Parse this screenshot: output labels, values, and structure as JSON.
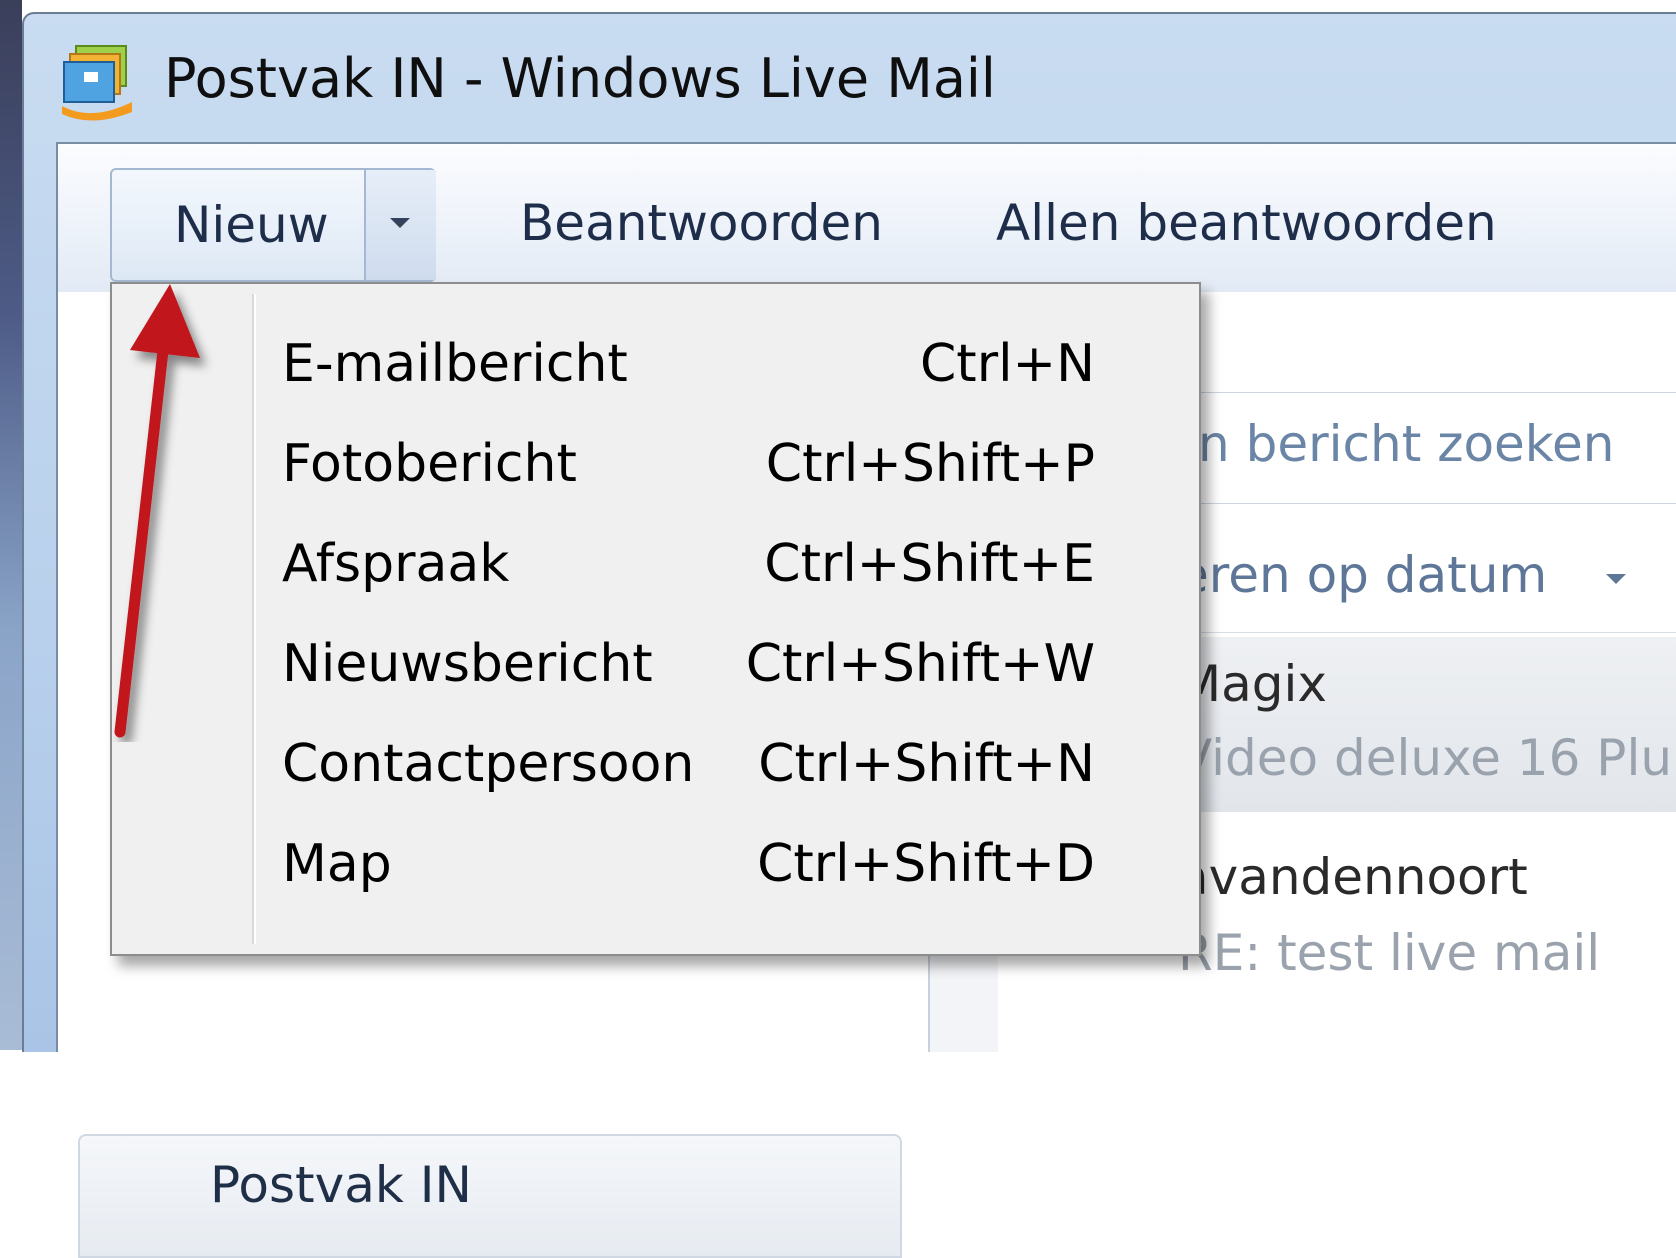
{
  "window": {
    "title": "Postvak IN - Windows Live Mail"
  },
  "toolbar": {
    "new_label": "Nieuw",
    "reply_label": "Beantwoorden",
    "reply_all_label": "Allen beantwoorden"
  },
  "new_menu": {
    "items": [
      {
        "label": "E-mailbericht",
        "shortcut": "Ctrl+N"
      },
      {
        "label": "Fotobericht",
        "shortcut": "Ctrl+Shift+P"
      },
      {
        "label": "Afspraak",
        "shortcut": "Ctrl+Shift+E"
      },
      {
        "label": "Nieuwsbericht",
        "shortcut": "Ctrl+Shift+W"
      },
      {
        "label": "Contactpersoon",
        "shortcut": "Ctrl+Shift+N"
      },
      {
        "label": "Map",
        "shortcut": "Ctrl+Shift+D"
      }
    ]
  },
  "folders": {
    "inbox_label": "Postvak IN"
  },
  "message_list": {
    "search_placeholder": "n bericht zoeken",
    "sort_label": "eren op datum",
    "messages": [
      {
        "from": "Magix",
        "subject": "Video deluxe 16 Plu"
      },
      {
        "from": "avandennoort",
        "subject": "RE: test live mail"
      }
    ]
  },
  "colors": {
    "annotation_arrow": "#c0121a",
    "title_bar": "#bdd3ee",
    "menu_background": "#f0f0f0"
  }
}
